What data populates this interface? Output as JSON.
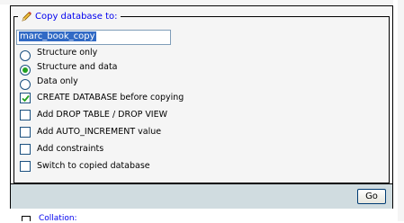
{
  "legend": {
    "icon": "pencil-icon",
    "label": "Copy database to:"
  },
  "new_name": {
    "value": "marc_book_copy"
  },
  "mode_options": [
    {
      "label": "Structure only",
      "checked": false
    },
    {
      "label": "Structure and data",
      "checked": true
    },
    {
      "label": "Data only",
      "checked": false
    }
  ],
  "checkbox_options": [
    {
      "label": "CREATE DATABASE before copying",
      "checked": true
    },
    {
      "label": "Add DROP TABLE / DROP VIEW",
      "checked": false
    },
    {
      "label": "Add AUTO_INCREMENT value",
      "checked": false
    },
    {
      "label": "Add constraints",
      "checked": false
    },
    {
      "label": "Switch to copied database",
      "checked": false
    }
  ],
  "go_label": "Go",
  "collation": {
    "icon": "collation-icon",
    "label": "Collation:"
  },
  "colors": {
    "link": "#0000ee",
    "footer": "#d0dce0",
    "panel": "#f5f5f5",
    "radio_checked": "#21a121"
  }
}
